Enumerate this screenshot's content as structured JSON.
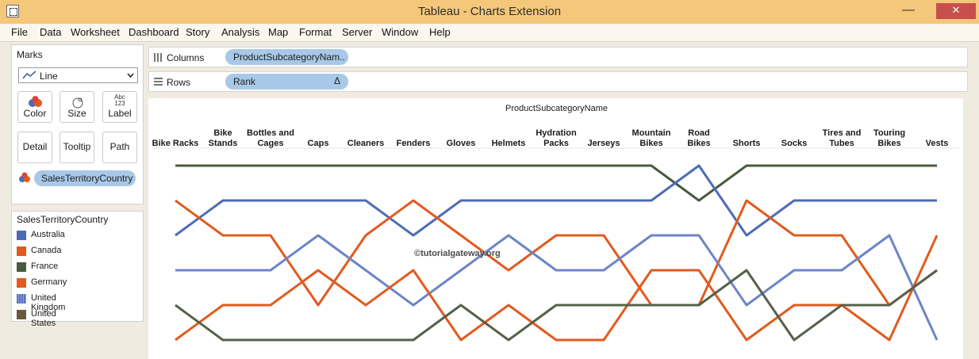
{
  "window": {
    "title": "Tableau - Charts Extension",
    "min_label": "—",
    "close_label": "✕"
  },
  "menu": [
    "File",
    "Data",
    "Worksheet",
    "Dashboard",
    "Story",
    "Analysis",
    "Map",
    "Format",
    "Server",
    "Window",
    "Help"
  ],
  "marks": {
    "title": "Marks",
    "type": "Line",
    "buttons": {
      "color": "Color",
      "size": "Size",
      "label": "Label",
      "detail": "Detail",
      "tooltip": "Tooltip",
      "path": "Path"
    },
    "label_icon_text": "Abc\n123",
    "color_pill": "SalesTerritoryCountry"
  },
  "legend": {
    "title": "SalesTerritoryCountry",
    "items": [
      {
        "label": "Australia",
        "color": "#4e6bb5"
      },
      {
        "label": "Canada",
        "color": "#e25a1e"
      },
      {
        "label": "France",
        "color": "#4a5a3e"
      },
      {
        "label": "Germany",
        "color": "#e25a1e"
      },
      {
        "label": "United Kingdom",
        "color": "#5b76c0"
      },
      {
        "label": "United States",
        "color": "#6b5a3a"
      }
    ]
  },
  "shelves": {
    "columns_label": "Columns",
    "columns_pill": "ProductSubcategoryNam..",
    "rows_label": "Rows",
    "rows_pill": "Rank",
    "rows_pill_delta": "Δ"
  },
  "watermark": "©tutorialgateway.org",
  "chart_data": {
    "type": "line",
    "title": "ProductSubcategoryName",
    "categories": [
      "Bike Racks",
      "Bike Stands",
      "Bottles and Cages",
      "Caps",
      "Cleaners",
      "Fenders",
      "Gloves",
      "Helmets",
      "Hydration Packs",
      "Jerseys",
      "Mountain Bikes",
      "Road Bikes",
      "Shorts",
      "Socks",
      "Tires and Tubes",
      "Touring Bikes",
      "Vests"
    ],
    "y_reversed": true,
    "ylim": [
      1,
      6
    ],
    "series": [
      {
        "color": "#4a5a3e",
        "values": [
          1,
          1,
          1,
          1,
          1,
          1,
          1,
          1,
          1,
          1,
          1,
          2,
          1,
          1,
          1,
          1,
          1
        ]
      },
      {
        "color": "#4e6bb5",
        "values": [
          3,
          2,
          2,
          2,
          2,
          3,
          2,
          2,
          2,
          2,
          2,
          1,
          3,
          2,
          2,
          2,
          2
        ]
      },
      {
        "color": "#e25a1e",
        "values": [
          2,
          3,
          3,
          5,
          3,
          2,
          3,
          4,
          3,
          3,
          5,
          5,
          2,
          3,
          3,
          5,
          4
        ]
      },
      {
        "color": "#6d84c6",
        "values": [
          4,
          4,
          4,
          3,
          4,
          5,
          4,
          3,
          4,
          4,
          3,
          3,
          5,
          4,
          4,
          3,
          6
        ]
      },
      {
        "color": "#e25a1e",
        "values": [
          6,
          5,
          5,
          4,
          5,
          4,
          6,
          5,
          6,
          6,
          4,
          4,
          6,
          5,
          5,
          6,
          3
        ]
      },
      {
        "color": "#56614a",
        "values": [
          5,
          6,
          6,
          6,
          6,
          6,
          5,
          6,
          5,
          5,
          5,
          5,
          4,
          6,
          5,
          5,
          4
        ]
      }
    ]
  }
}
